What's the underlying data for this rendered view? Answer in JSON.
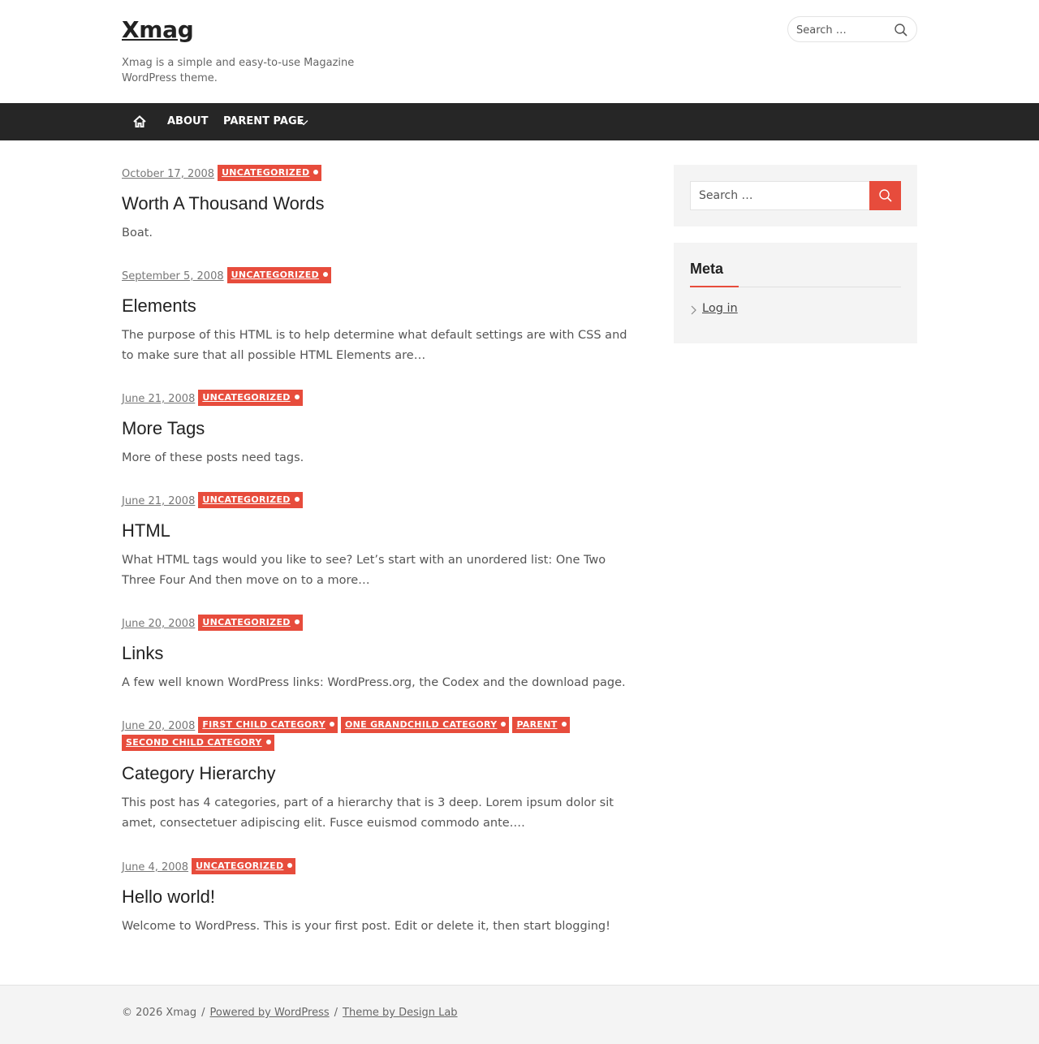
{
  "site": {
    "title": "Xmag",
    "description": "Xmag is a simple and easy-to-use Magazine WordPress theme."
  },
  "header_search": {
    "placeholder": "Search …"
  },
  "nav": {
    "items": [
      {
        "label": "About"
      },
      {
        "label": "Parent Page"
      }
    ]
  },
  "posts": [
    {
      "date": "October 17, 2008",
      "categories": [
        "Uncategorized"
      ],
      "title": "Worth A Thousand Words",
      "excerpt": "Boat."
    },
    {
      "date": "September 5, 2008",
      "categories": [
        "Uncategorized"
      ],
      "title": "Elements",
      "excerpt": "The purpose of this HTML is to help determine what default settings are with CSS and to make sure that all possible HTML Elements are…"
    },
    {
      "date": "June 21, 2008",
      "categories": [
        "Uncategorized"
      ],
      "title": "More Tags",
      "excerpt": "More of these posts need tags."
    },
    {
      "date": "June 21, 2008",
      "categories": [
        "Uncategorized"
      ],
      "title": "HTML",
      "excerpt": "What HTML tags would you like to see? Let’s start with an unordered list: One Two Three Four And then move on to a more…"
    },
    {
      "date": "June 20, 2008",
      "categories": [
        "Uncategorized"
      ],
      "title": "Links",
      "excerpt": "A few well known WordPress links: WordPress.org, the Codex and the download page."
    },
    {
      "date": "June 20, 2008",
      "categories": [
        "First Child Category",
        "One Grandchild Category",
        "Parent",
        "Second Child Category"
      ],
      "title": "Category Hierarchy",
      "excerpt": "This post has 4 categories, part of a hierarchy that is 3 deep. Lorem ipsum dolor sit amet, consectetuer adipiscing elit. Fusce euismod commodo ante.…"
    },
    {
      "date": "June 4, 2008",
      "categories": [
        "Uncategorized"
      ],
      "title": "Hello world!",
      "excerpt": "Welcome to WordPress. This is your first post. Edit or delete it, then start blogging!"
    }
  ],
  "sidebar": {
    "search_placeholder": "Search …",
    "meta": {
      "title": "Meta",
      "items": [
        {
          "label": "Log in"
        }
      ]
    }
  },
  "footer": {
    "copyright": "© 2026 Xmag",
    "separator": "/",
    "powered_by": "Powered by WordPress",
    "theme_by": "Theme by Design Lab"
  },
  "colors": {
    "accent": "#e74c3c",
    "nav_bg": "#262626",
    "widget_bg": "#f4f4f4"
  }
}
